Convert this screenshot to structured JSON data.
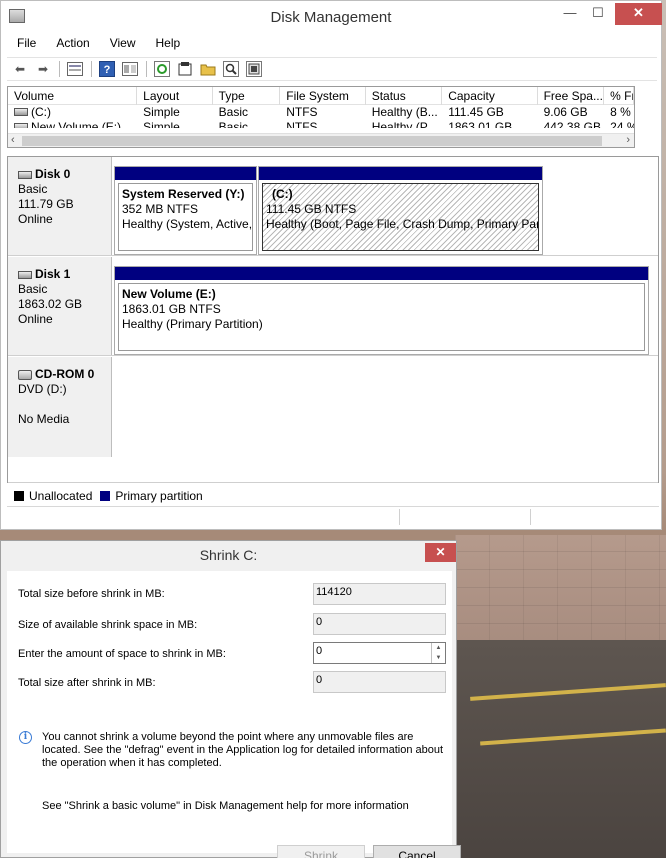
{
  "main_window": {
    "title": "Disk Management",
    "controls": {
      "minimize": "—",
      "maximize": "☐",
      "close": "✕"
    },
    "menu": [
      "File",
      "Action",
      "View",
      "Help"
    ],
    "toolbar_icons": [
      "back-arrow-icon",
      "forward-arrow-icon",
      "properties-list-icon",
      "help-icon",
      "view-icon",
      "refresh-icon",
      "rescan-icon",
      "open-folder-icon",
      "search-icon",
      "settings-icon"
    ]
  },
  "volume_list": {
    "columns": [
      "Volume",
      "Layout",
      "Type",
      "File System",
      "Status",
      "Capacity",
      "Free Spa...",
      "% Fr"
    ],
    "rows": [
      [
        "(C:)",
        "Simple",
        "Basic",
        "NTFS",
        "Healthy (B...",
        "111.45 GB",
        "9.06 GB",
        "8 %"
      ],
      [
        "New Volume (E:)",
        "Simple",
        "Basic",
        "NTFS",
        "Healthy (P...",
        "1863.01 GB",
        "442.38 GB",
        "24 %"
      ]
    ]
  },
  "disks": [
    {
      "name": "Disk 0",
      "type": "Basic",
      "size": "111.79 GB",
      "state": "Online",
      "partitions": [
        {
          "label": "System Reserved  (Y:)",
          "size": "352 MB NTFS",
          "status": "Healthy (System, Active,"
        },
        {
          "label": "(C:)",
          "size": "111.45 GB NTFS",
          "status": "Healthy (Boot, Page File, Crash Dump, Primary Partiti"
        }
      ]
    },
    {
      "name": "Disk 1",
      "type": "Basic",
      "size": "1863.02 GB",
      "state": "Online",
      "partitions": [
        {
          "label": "New Volume  (E:)",
          "size": "1863.01 GB NTFS",
          "status": "Healthy (Primary Partition)"
        }
      ]
    },
    {
      "name": "CD-ROM 0",
      "type": "DVD (D:)",
      "media": "No Media"
    }
  ],
  "legend": [
    {
      "label": "Unallocated",
      "color": "#000000"
    },
    {
      "label": "Primary partition",
      "color": "#000080"
    }
  ],
  "shrink_dialog": {
    "title": "Shrink C:",
    "close": "✕",
    "fields": [
      {
        "label": "Total size before shrink in MB:",
        "value": "114120"
      },
      {
        "label": "Size of available shrink space in MB:",
        "value": "0"
      },
      {
        "label": "Enter the amount of space to shrink in MB:",
        "value": "0"
      },
      {
        "label": "Total size after shrink in MB:",
        "value": "0"
      }
    ],
    "info": "You cannot shrink a volume beyond the point where any unmovable files are located. See the \"defrag\" event in the Application log for detailed information about the operation when it has completed.",
    "help": "See \"Shrink a basic volume\" in Disk Management help for more information",
    "shrink_button": "Shrink",
    "cancel_button": "Cancel"
  }
}
